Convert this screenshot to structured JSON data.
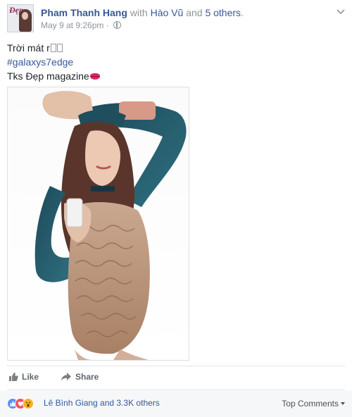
{
  "post": {
    "author": "Pham Thanh Hang",
    "with_text": "with",
    "with_name": "Hào Vũ",
    "and_text": "and",
    "others": "5 others",
    "timestamp": "May 9 at 9:26pm",
    "separator": "·",
    "lines": {
      "line1": "Trời mát r",
      "line2": "#galaxys7edge",
      "line3": "Tks Đẹp magazine"
    },
    "avatar_text": "Đẹp"
  },
  "actions": {
    "like": "Like",
    "share": "Share"
  },
  "footer": {
    "likers": "Lê Bình Giang and 3.3K others",
    "top_comments": "Top Comments"
  },
  "icons": {
    "reactions": [
      "like-icon",
      "love-icon",
      "wow-icon"
    ],
    "privacy": "globe-icon",
    "menu": "chevron-down-icon"
  },
  "colors": {
    "link": "#365899",
    "meta": "#90949c",
    "like_reaction": "#5890ff",
    "love_reaction": "#f25268",
    "wow_reaction": "#f7b125"
  }
}
